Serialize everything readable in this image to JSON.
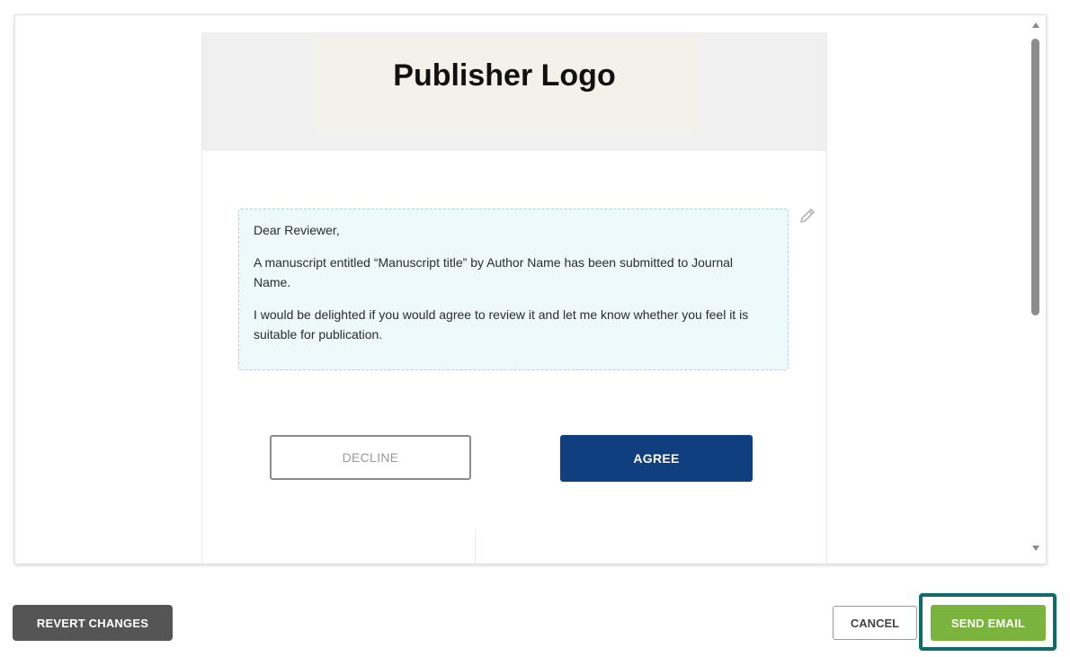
{
  "email_preview": {
    "logo_text": "Publisher Logo",
    "message": {
      "greeting": "Dear Reviewer,",
      "paragraph_1": "A manuscript entitled “Manuscript title” by Author Name has been submitted to Journal Name.",
      "paragraph_2": "I would be delighted if you would agree to review it and let me know whether you feel it is suitable for publication."
    },
    "decline_label": "DECLINE",
    "agree_label": "AGREE"
  },
  "footer": {
    "revert_label": "REVERT CHANGES",
    "cancel_label": "CANCEL",
    "send_label": "SEND EMAIL"
  },
  "icons": {
    "edit": "pencil-icon",
    "scroll_up": "arrow-up-icon",
    "scroll_down": "arrow-down-icon"
  },
  "colors": {
    "agree_button": "#0f3f7e",
    "send_button": "#7ab33e",
    "focus_ring": "#0e6b6b",
    "revert_button": "#555555",
    "message_background": "#eef9fb"
  }
}
